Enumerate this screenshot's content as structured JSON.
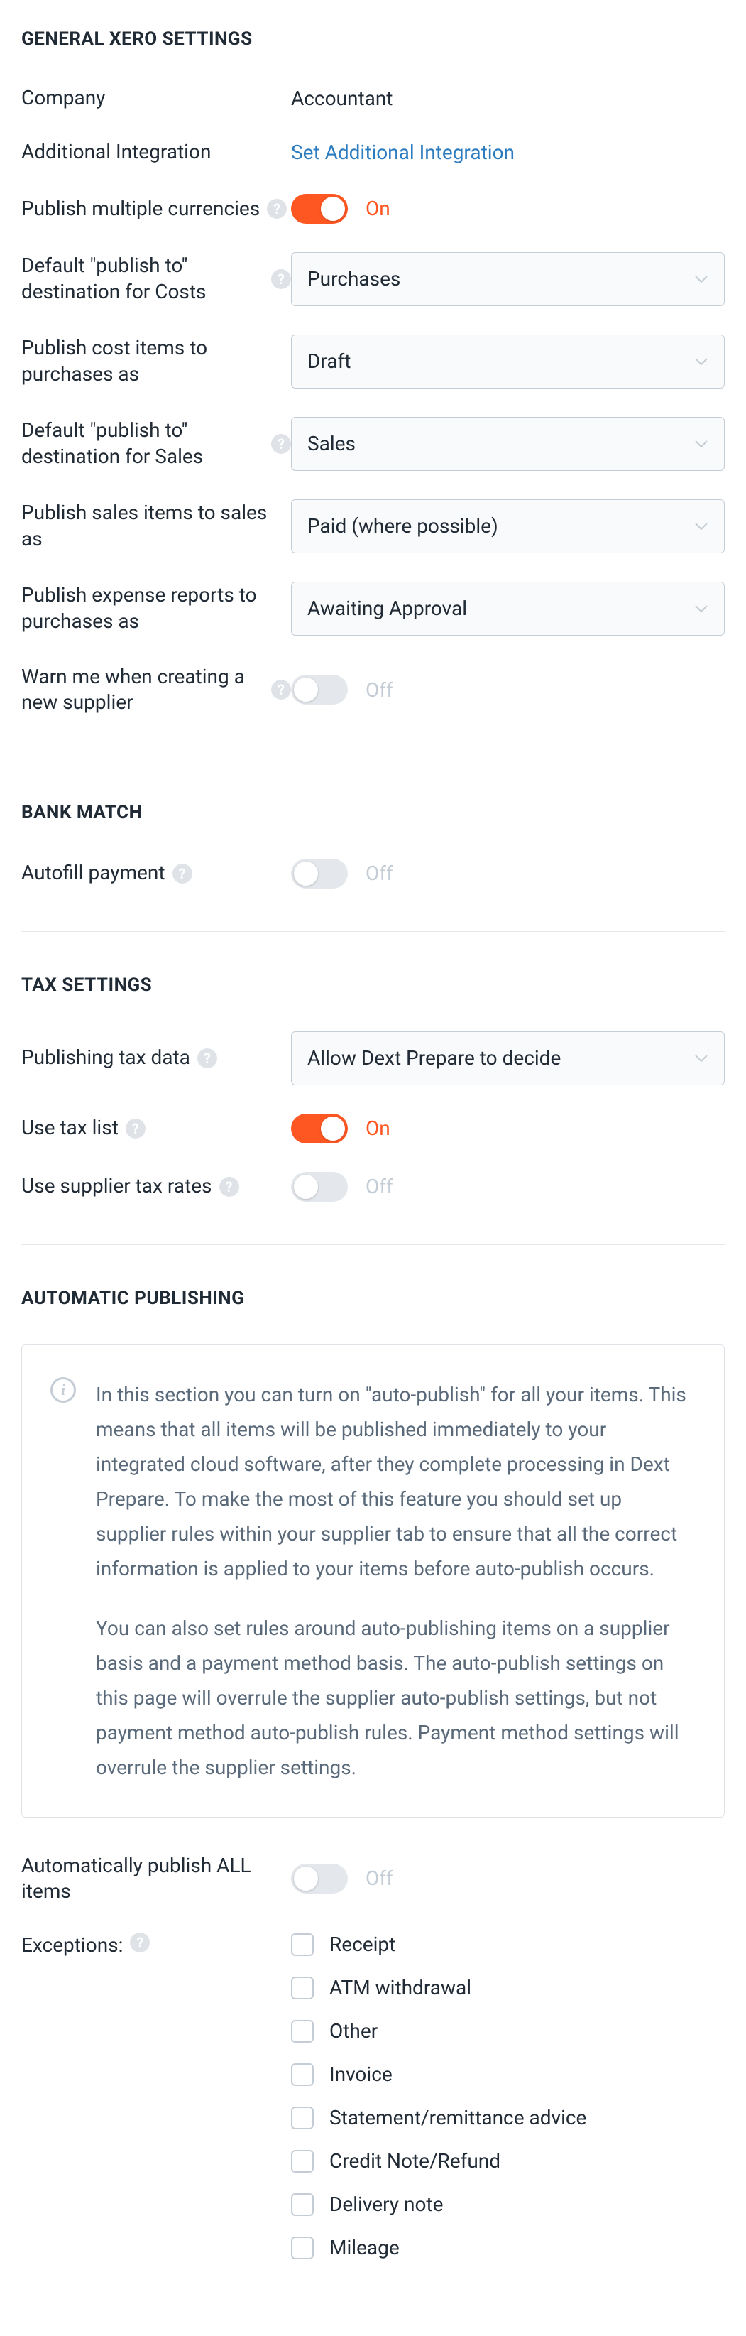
{
  "sections": {
    "general": {
      "title": "GENERAL XERO SETTINGS",
      "company_label": "Company",
      "company_value": "Accountant",
      "integration_label": "Additional Integration",
      "integration_link": "Set Additional Integration",
      "multi_curr_label": "Publish multiple currencies",
      "multi_curr_state": "On",
      "costs_dest_label": "Default \"publish to\" destination for Costs",
      "costs_dest_value": "Purchases",
      "cost_items_label": "Publish cost items to purchases as",
      "cost_items_value": "Draft",
      "sales_dest_label": "Default \"publish to\" destination for Sales",
      "sales_dest_value": "Sales",
      "sales_items_label": "Publish sales items to sales as",
      "sales_items_value": "Paid (where possible)",
      "expense_reports_label": "Publish expense reports to purchases as",
      "expense_reports_value": "Awaiting Approval",
      "warn_supplier_label": "Warn me when creating a new supplier",
      "warn_supplier_state": "Off"
    },
    "bank": {
      "title": "BANK MATCH",
      "autofill_label": "Autofill payment",
      "autofill_state": "Off"
    },
    "tax": {
      "title": "TAX SETTINGS",
      "pub_tax_label": "Publishing tax data",
      "pub_tax_value": "Allow Dext Prepare to decide",
      "tax_list_label": "Use tax list",
      "tax_list_state": "On",
      "supplier_tax_label": "Use supplier tax rates",
      "supplier_tax_state": "Off"
    },
    "auto": {
      "title": "AUTOMATIC PUBLISHING",
      "info_p1": "In this section you can turn on \"auto-publish\" for all your items. This means that all items will be published immediately to your integrated cloud software, after they complete processing in Dext Prepare. To make the most of this feature you should set up supplier rules within your supplier tab to ensure that all the correct information is applied to your items before auto-publish occurs.",
      "info_p2": "You can also set rules around auto-publishing items on a supplier basis and a payment method basis. The auto-publish settings on this page will overrule the supplier auto-publish settings, but not payment method auto-publish rules. Payment method settings will overrule the supplier settings.",
      "publish_all_label": "Automatically publish ALL items",
      "publish_all_state": "Off",
      "exceptions_label": "Exceptions:",
      "exceptions": [
        "Receipt",
        "ATM withdrawal",
        "Other",
        "Invoice",
        "Statement/remittance advice",
        "Credit Note/Refund",
        "Delivery note",
        "Mileage"
      ]
    }
  }
}
